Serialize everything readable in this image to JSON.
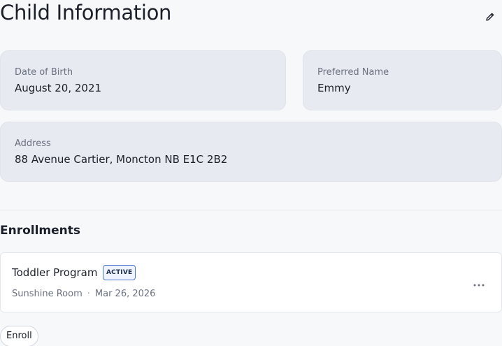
{
  "header": {
    "title": "Child Information",
    "edit_icon": "pencil-icon"
  },
  "details": {
    "date_of_birth": {
      "label": "Date of Birth",
      "value": "August 20, 2021"
    },
    "preferred_name": {
      "label": "Preferred Name",
      "value": "Emmy"
    },
    "address": {
      "label": "Address",
      "value": "88 Avenue Cartier, Moncton NB E1C 2B2"
    }
  },
  "enrollments": {
    "title": "Enrollments",
    "items": [
      {
        "program": "Toddler Program",
        "status": "ACTIVE",
        "room": "Sunshine Room",
        "separator": "·",
        "date": "Mar 26, 2026",
        "menu_icon": "more-horizontal-icon"
      }
    ],
    "enroll_label": "Enroll"
  },
  "colors": {
    "card_bg": "#e7eaf0",
    "badge_border": "#4a74c9",
    "muted_text": "#6b7181"
  }
}
